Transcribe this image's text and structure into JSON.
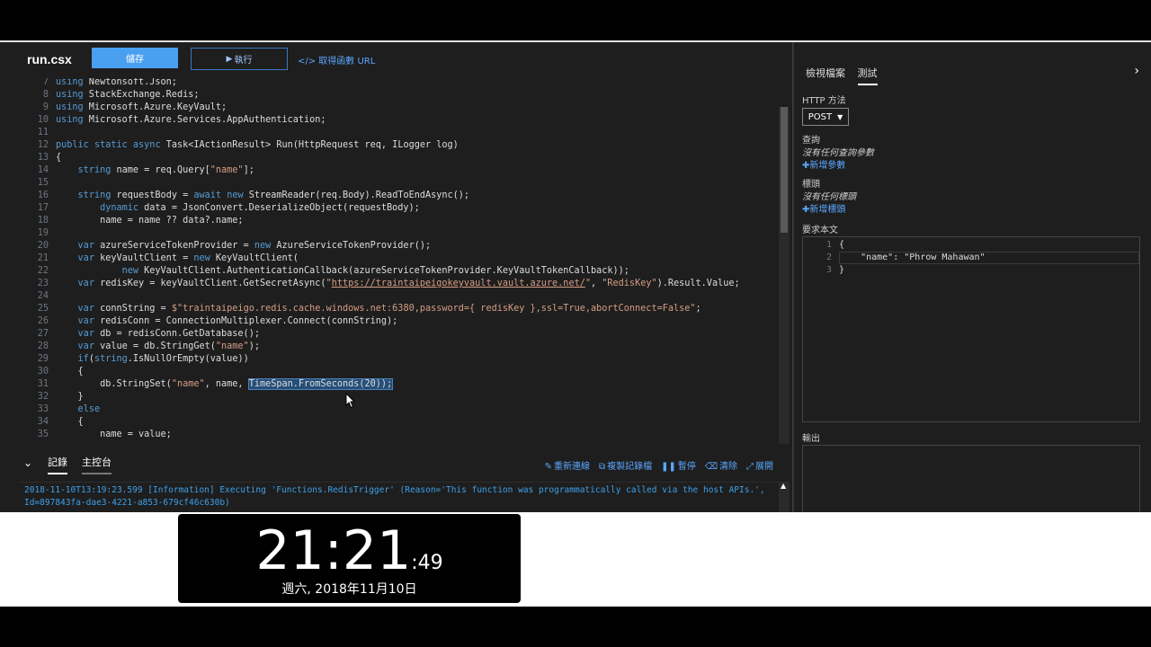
{
  "editor": {
    "file_title": "run.csx",
    "save_label": "儲存",
    "run_label": "執行",
    "url_label": "</> 取得函數 URL",
    "code_lines": [
      {
        "n": "7",
        "text": "using Newtonsoft.Json;"
      },
      {
        "n": "8",
        "text": "using StackExchange.Redis;"
      },
      {
        "n": "9",
        "text": "using Microsoft.Azure.KeyVault;"
      },
      {
        "n": "10",
        "text": "using Microsoft.Azure.Services.AppAuthentication;"
      },
      {
        "n": "11",
        "text": ""
      },
      {
        "n": "12",
        "text": "public static async Task<IActionResult> Run(HttpRequest req, ILogger log)"
      },
      {
        "n": "13",
        "text": "{"
      },
      {
        "n": "14",
        "text": "    string name = req.Query[\"name\"];"
      },
      {
        "n": "15",
        "text": ""
      },
      {
        "n": "16",
        "text": "    string requestBody = await new StreamReader(req.Body).ReadToEndAsync();"
      },
      {
        "n": "17",
        "text": "        dynamic data = JsonConvert.DeserializeObject(requestBody);"
      },
      {
        "n": "18",
        "text": "        name = name ?? data?.name;"
      },
      {
        "n": "19",
        "text": ""
      },
      {
        "n": "20",
        "text": "    var azureServiceTokenProvider = new AzureServiceTokenProvider();"
      },
      {
        "n": "21",
        "text": "    var keyVaultClient = new KeyVaultClient("
      },
      {
        "n": "22",
        "text": "            new KeyVaultClient.AuthenticationCallback(azureServiceTokenProvider.KeyVaultTokenCallback));"
      },
      {
        "n": "23",
        "text": "    var redisKey = keyVaultClient.GetSecretAsync(\"https://traintaipeigokeyvault.vault.azure.net/\", \"RedisKey\").Result.Value;"
      },
      {
        "n": "24",
        "text": ""
      },
      {
        "n": "25",
        "text": "    var connString = $\"traintaipeigo.redis.cache.windows.net:6380,password={ redisKey },ssl=True,abortConnect=False\";"
      },
      {
        "n": "26",
        "text": "    var redisConn = ConnectionMultiplexer.Connect(connString);"
      },
      {
        "n": "27",
        "text": "    var db = redisConn.GetDatabase();"
      },
      {
        "n": "28",
        "text": "    var value = db.StringGet(\"name\");"
      },
      {
        "n": "29",
        "text": "    if(string.IsNullOrEmpty(value))"
      },
      {
        "n": "30",
        "text": "    {"
      },
      {
        "n": "31",
        "text": "        db.StringSet(\"name\", name, TimeSpan.FromSeconds(20));"
      },
      {
        "n": "32",
        "text": "    }"
      },
      {
        "n": "33",
        "text": "    else"
      },
      {
        "n": "34",
        "text": "    {"
      },
      {
        "n": "35",
        "text": "        name = value;"
      }
    ]
  },
  "log_panel": {
    "tab_logs": "記錄",
    "tab_console": "主控台",
    "actions": [
      {
        "icon": "refresh-icon",
        "glyph": "✎",
        "label": "重新連線"
      },
      {
        "icon": "copy-icon",
        "glyph": "⧉",
        "label": "複製記錄檔"
      },
      {
        "icon": "pause-icon",
        "glyph": "❚❚",
        "label": "暫停"
      },
      {
        "icon": "clear-icon",
        "glyph": "⌫",
        "label": "清除"
      },
      {
        "icon": "expand-icon",
        "glyph": "⤢",
        "label": "展開"
      }
    ],
    "log_text": "2018-11-10T13:19:23.599 [Information] Executing 'Functions.RedisTrigger' (Reason='This function was programmatically called via the host APIs.', Id=897843fa-dae3-4221-a853-679cf46c630b)"
  },
  "side": {
    "tab_view_files": "檢視檔案",
    "tab_test": "測試",
    "http_method_label": "HTTP 方法",
    "http_method_value": "POST",
    "query_label": "查詢",
    "query_empty": "沒有任何查詢參數",
    "add_param": "新增參數",
    "headers_label": "標頭",
    "headers_empty": "沒有任何標頭",
    "add_header": "新增標頭",
    "body_label": "要求本文",
    "body_lines": [
      {
        "n": "1",
        "text": "{"
      },
      {
        "n": "2",
        "text": "    \"name\": \"Phrow Mahawan\""
      },
      {
        "n": "3",
        "text": "}"
      }
    ],
    "output_label": "輸出"
  },
  "clock": {
    "hm": "21:21",
    "sec": ":49",
    "date": "週六, 2018年11月10日"
  },
  "colors": {
    "accent": "#4aa0f0",
    "link": "#5aa7ff",
    "keyword": "#569cd6",
    "string": "#d69d85",
    "log": "#3ea0ea"
  }
}
